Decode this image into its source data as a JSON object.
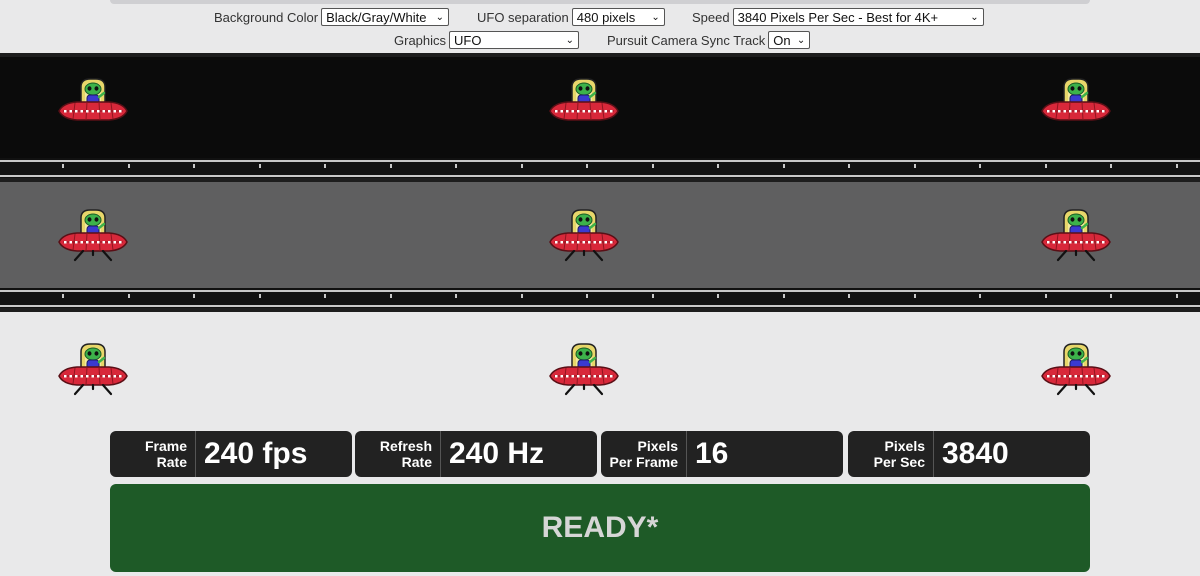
{
  "controls": {
    "background_color": {
      "label": "Background Color",
      "value": "Black/Gray/White"
    },
    "ufo_separation": {
      "label": "UFO separation",
      "value": "480 pixels"
    },
    "speed": {
      "label": "Speed",
      "value": "3840 Pixels Per Sec - Best for 4K+"
    },
    "graphics": {
      "label": "Graphics",
      "value": "UFO"
    },
    "pursuit_camera": {
      "label": "Pursuit Camera Sync Track",
      "value": "On"
    }
  },
  "tracks": [
    {
      "name": "black",
      "color": "#0b0b0b"
    },
    {
      "name": "gray",
      "color": "#5f5f60"
    },
    {
      "name": "white",
      "color": "#e9e9ea"
    }
  ],
  "stats": [
    {
      "label_line1": "Frame",
      "label_line2": "Rate",
      "value": "240 fps"
    },
    {
      "label_line1": "Refresh",
      "label_line2": "Rate",
      "value": "240 Hz"
    },
    {
      "label_line1": "Pixels",
      "label_line2": "Per Frame",
      "value": "16"
    },
    {
      "label_line1": "Pixels",
      "label_line2": "Per Sec",
      "value": "3840"
    }
  ],
  "status": {
    "text": "READY*",
    "color": "#1e5a27"
  },
  "icons": {
    "ufo": "ufo-alien-icon"
  }
}
